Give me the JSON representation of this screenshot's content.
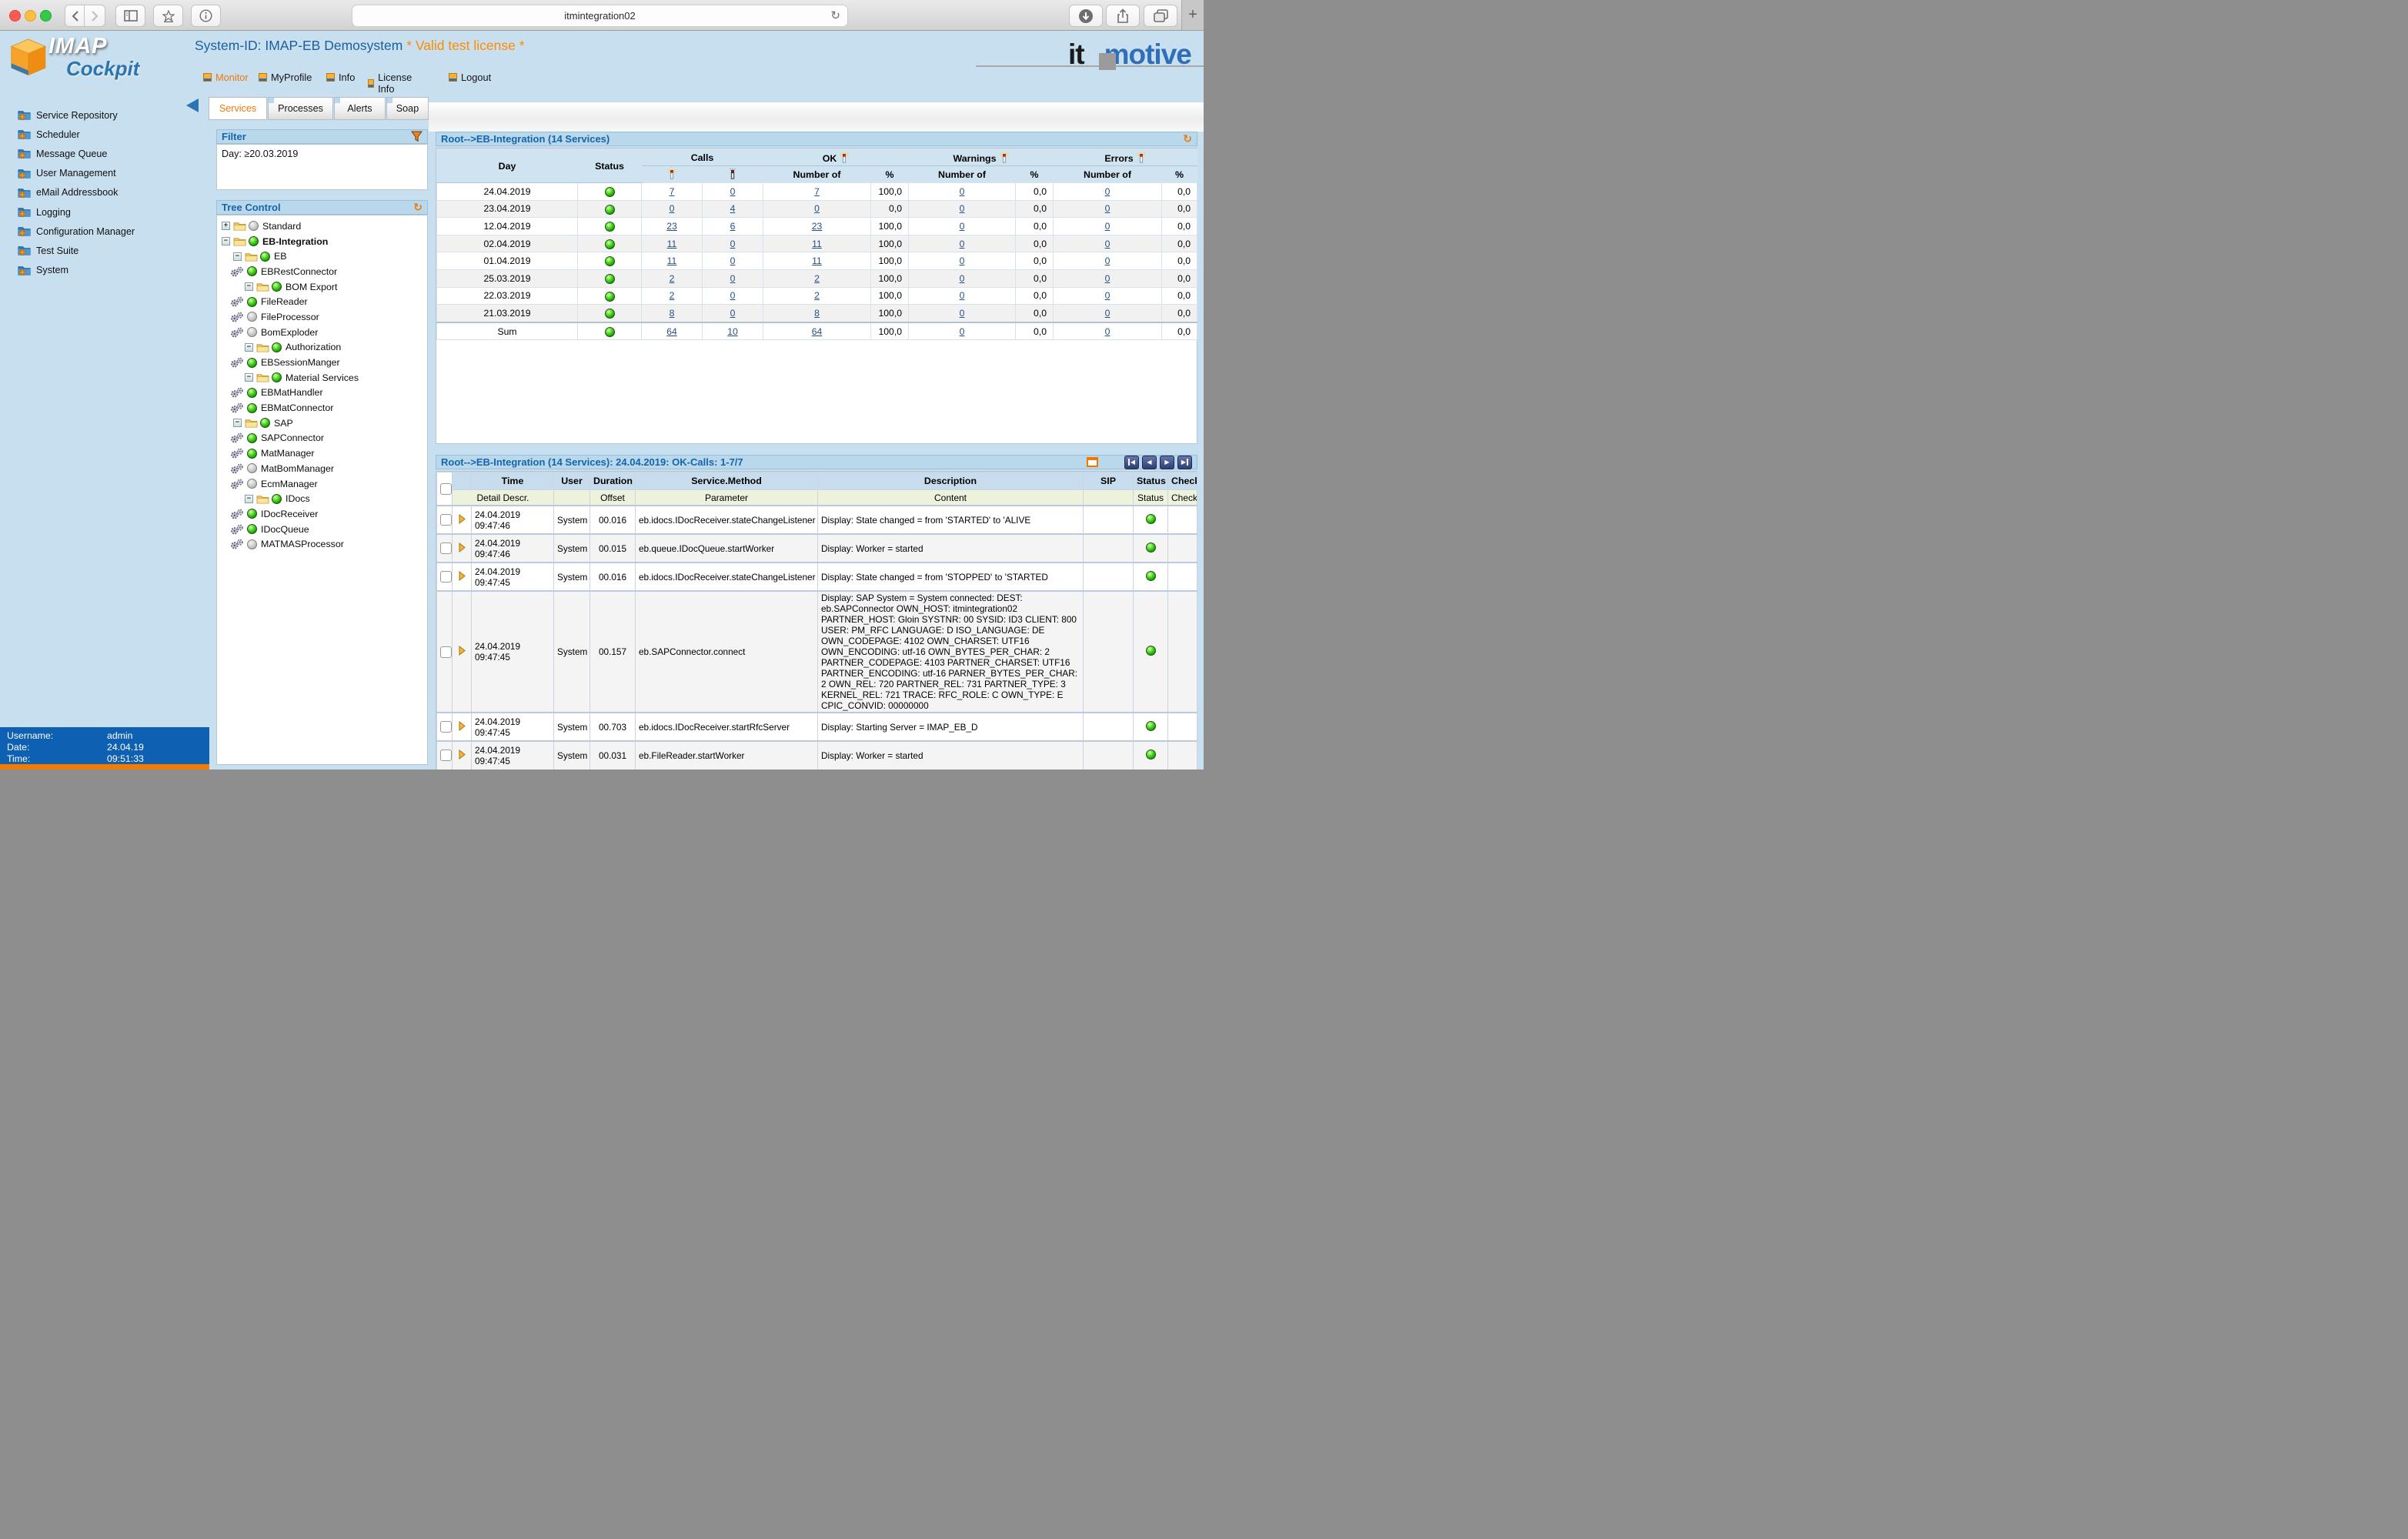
{
  "browser": {
    "url": "itmintegration02"
  },
  "sidebar": {
    "logo_line1": "IMAP",
    "logo_line2": "Cockpit",
    "items": [
      {
        "label": "Service Repository"
      },
      {
        "label": "Scheduler"
      },
      {
        "label": "Message Queue"
      },
      {
        "label": "User Management"
      },
      {
        "label": "eMail Addressbook"
      },
      {
        "label": "Logging"
      },
      {
        "label": "Configuration Manager"
      },
      {
        "label": "Test Suite"
      },
      {
        "label": "System"
      }
    ],
    "session": {
      "username_label": "Username:",
      "username": "admin",
      "date_label": "Date:",
      "date": "24.04.19",
      "time_label": "Time:",
      "time": "09:51:33"
    }
  },
  "header": {
    "system_id": "System-ID: IMAP-EB Demosystem",
    "license": " * Valid test license *",
    "brand_it": "it",
    "brand_motive": "motive",
    "nav": [
      {
        "label": "Monitor"
      },
      {
        "label": "MyProfile"
      },
      {
        "label": "Info"
      },
      {
        "label": "License Info"
      },
      {
        "label": "Logout"
      }
    ]
  },
  "tabs": [
    {
      "label": "Services"
    },
    {
      "label": "Processes"
    },
    {
      "label": "Alerts"
    },
    {
      "label": "Soap"
    }
  ],
  "filter": {
    "title": "Filter",
    "day": "Day:  ≥20.03.2019"
  },
  "tree": {
    "title": "Tree Control",
    "nodes": [
      {
        "label": "Standard",
        "led": "led gray"
      },
      {
        "label": "EB-Integration",
        "led": "led green"
      },
      {
        "label": "EB",
        "led": "led green"
      },
      {
        "label": "EBRestConnector",
        "led": "led green"
      },
      {
        "label": "BOM Export",
        "led": "led green"
      },
      {
        "label": "FileReader",
        "led": "led green"
      },
      {
        "label": "FileProcessor",
        "led": "led gray"
      },
      {
        "label": "BomExploder",
        "led": "led gray"
      },
      {
        "label": "Authorization",
        "led": "led green"
      },
      {
        "label": "EBSessionManger",
        "led": "led green"
      },
      {
        "label": "Material Services",
        "led": "led green"
      },
      {
        "label": "EBMatHandler",
        "led": "led green"
      },
      {
        "label": "EBMatConnector",
        "led": "led green"
      },
      {
        "label": "SAP",
        "led": "led green"
      },
      {
        "label": "SAPConnector",
        "led": "led green"
      },
      {
        "label": "MatManager",
        "led": "led green"
      },
      {
        "label": "MatBomManager",
        "led": "led gray"
      },
      {
        "label": "EcmManager",
        "led": "led gray"
      },
      {
        "label": "IDocs",
        "led": "led green"
      },
      {
        "label": "IDocReceiver",
        "led": "led green"
      },
      {
        "label": "IDocQueue",
        "led": "led green"
      },
      {
        "label": "MATMASProcessor",
        "led": "led gray"
      }
    ]
  },
  "services_table": {
    "title": "Root-->EB-Integration (14 Services)",
    "headers": {
      "day": "Day",
      "status": "Status",
      "calls": "Calls",
      "ok": "OK",
      "warnings": "Warnings",
      "errors": "Errors",
      "number_of": "Number of",
      "percent": "%"
    },
    "rows": [
      {
        "day": "24.04.2019",
        "c1": "7",
        "c2": "0",
        "okn": "7",
        "okp": "100,0",
        "wn": "0",
        "wp": "0,0",
        "en": "0",
        "ep": "0,0"
      },
      {
        "day": "23.04.2019",
        "c1": "0",
        "c2": "4",
        "okn": "0",
        "okp": "0,0",
        "wn": "0",
        "wp": "0,0",
        "en": "0",
        "ep": "0,0"
      },
      {
        "day": "12.04.2019",
        "c1": "23",
        "c2": "6",
        "okn": "23",
        "okp": "100,0",
        "wn": "0",
        "wp": "0,0",
        "en": "0",
        "ep": "0,0"
      },
      {
        "day": "02.04.2019",
        "c1": "11",
        "c2": "0",
        "okn": "11",
        "okp": "100,0",
        "wn": "0",
        "wp": "0,0",
        "en": "0",
        "ep": "0,0"
      },
      {
        "day": "01.04.2019",
        "c1": "11",
        "c2": "0",
        "okn": "11",
        "okp": "100,0",
        "wn": "0",
        "wp": "0,0",
        "en": "0",
        "ep": "0,0"
      },
      {
        "day": "25.03.2019",
        "c1": "2",
        "c2": "0",
        "okn": "2",
        "okp": "100,0",
        "wn": "0",
        "wp": "0,0",
        "en": "0",
        "ep": "0,0"
      },
      {
        "day": "22.03.2019",
        "c1": "2",
        "c2": "0",
        "okn": "2",
        "okp": "100,0",
        "wn": "0",
        "wp": "0,0",
        "en": "0",
        "ep": "0,0"
      },
      {
        "day": "21.03.2019",
        "c1": "8",
        "c2": "0",
        "okn": "8",
        "okp": "100,0",
        "wn": "0",
        "wp": "0,0",
        "en": "0",
        "ep": "0,0"
      },
      {
        "day": "Sum",
        "c1": "64",
        "c2": "10",
        "okn": "64",
        "okp": "100,0",
        "wn": "0",
        "wp": "0,0",
        "en": "0",
        "ep": "0,0"
      }
    ]
  },
  "calls_table": {
    "title": "Root-->EB-Integration (14 Services): 24.04.2019: OK-Calls: 1-7/7",
    "headers": {
      "time": "Time",
      "user": "User",
      "duration": "Duration",
      "method": "Service.Method",
      "description": "Description",
      "sip": "SIP",
      "status": "Status",
      "checked": "Checked",
      "detail": "Detail Descr.",
      "offset": "Offset",
      "parameter": "Parameter",
      "content": "Content"
    },
    "rows": [
      {
        "date": "24.04.2019",
        "time": "09:47:46",
        "user": "System",
        "duration": "00.016",
        "method": "eb.idocs.IDocReceiver.stateChangeListener",
        "description": "Display: State changed = from 'STARTED' to 'ALIVE"
      },
      {
        "date": "24.04.2019",
        "time": "09:47:46",
        "user": "System",
        "duration": "00.015",
        "method": "eb.queue.IDocQueue.startWorker",
        "description": "Display: Worker = started"
      },
      {
        "date": "24.04.2019",
        "time": "09:47:45",
        "user": "System",
        "duration": "00.016",
        "method": "eb.idocs.IDocReceiver.stateChangeListener",
        "description": "Display: State changed = from 'STOPPED' to 'STARTED"
      },
      {
        "date": "24.04.2019",
        "time": "09:47:45",
        "user": "System",
        "duration": "00.157",
        "method": "eb.SAPConnector.connect",
        "description": "Display: SAP System = System connected: DEST: eb.SAPConnector OWN_HOST: itmintegration02 PARTNER_HOST: Gloin SYSTNR: 00 SYSID: ID3 CLIENT: 800 USER: PM_RFC LANGUAGE: D ISO_LANGUAGE: DE OWN_CODEPAGE: 4102 OWN_CHARSET: UTF16 OWN_ENCODING: utf-16 OWN_BYTES_PER_CHAR: 2 PARTNER_CODEPAGE: 4103 PARTNER_CHARSET: UTF16 PARTNER_ENCODING: utf-16 PARNER_BYTES_PER_CHAR: 2 OWN_REL: 720 PARTNER_REL: 731 PARTNER_TYPE: 3 KERNEL_REL: 721 TRACE: RFC_ROLE: C OWN_TYPE: E CPIC_CONVID: 00000000"
      },
      {
        "date": "24.04.2019",
        "time": "09:47:45",
        "user": "System",
        "duration": "00.703",
        "method": "eb.idocs.IDocReceiver.startRfcServer",
        "description": "Display: Starting Server = IMAP_EB_D"
      },
      {
        "date": "24.04.2019",
        "time": "09:47:45",
        "user": "System",
        "duration": "00.031",
        "method": "eb.FileReader.startWorker",
        "description": "Display: Worker = started"
      }
    ]
  }
}
